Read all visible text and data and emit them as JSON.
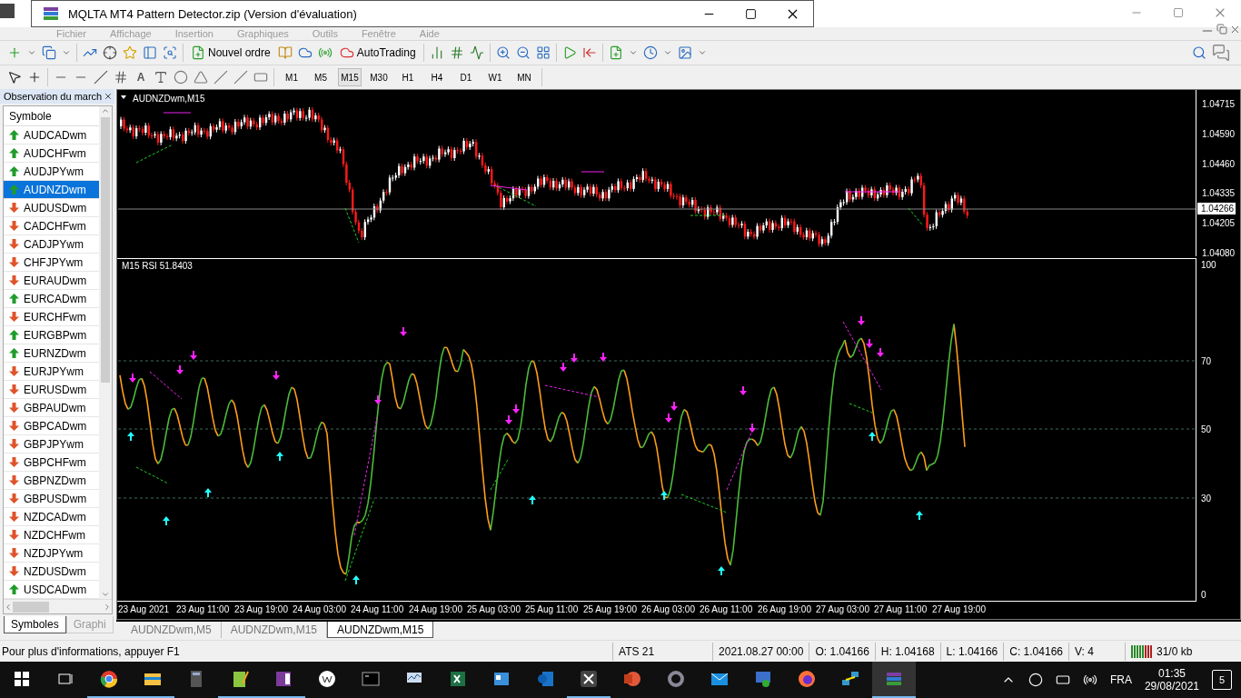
{
  "archive_window": {
    "title": "MQLTA MT4 Pattern Detector.zip (Version d'évaluation)"
  },
  "menu": [
    "Fichier",
    "Affichage",
    "Insertion",
    "Graphiques",
    "Outils",
    "Fenêtre",
    "Aide"
  ],
  "toolbar": {
    "new_order": "Nouvel ordre",
    "auto_trading": "AutoTrading",
    "text_tool": "A",
    "timeframes": [
      {
        "label": "M1",
        "selected": false
      },
      {
        "label": "M5",
        "selected": false
      },
      {
        "label": "M15",
        "selected": true
      },
      {
        "label": "M30",
        "selected": false
      },
      {
        "label": "H1",
        "selected": false
      },
      {
        "label": "H4",
        "selected": false
      },
      {
        "label": "D1",
        "selected": false
      },
      {
        "label": "W1",
        "selected": false
      },
      {
        "label": "MN",
        "selected": false
      }
    ]
  },
  "market_watch": {
    "title": "Observation du march",
    "column": "Symbole",
    "symbols": [
      {
        "name": "AUDCADwm",
        "up": true,
        "selected": false
      },
      {
        "name": "AUDCHFwm",
        "up": true,
        "selected": false
      },
      {
        "name": "AUDJPYwm",
        "up": true,
        "selected": false
      },
      {
        "name": "AUDNZDwm",
        "up": true,
        "selected": true
      },
      {
        "name": "AUDUSDwm",
        "up": false,
        "selected": false
      },
      {
        "name": "CADCHFwm",
        "up": false,
        "selected": false
      },
      {
        "name": "CADJPYwm",
        "up": false,
        "selected": false
      },
      {
        "name": "CHFJPYwm",
        "up": false,
        "selected": false
      },
      {
        "name": "EURAUDwm",
        "up": false,
        "selected": false
      },
      {
        "name": "EURCADwm",
        "up": true,
        "selected": false
      },
      {
        "name": "EURCHFwm",
        "up": false,
        "selected": false
      },
      {
        "name": "EURGBPwm",
        "up": true,
        "selected": false
      },
      {
        "name": "EURNZDwm",
        "up": true,
        "selected": false
      },
      {
        "name": "EURJPYwm",
        "up": false,
        "selected": false
      },
      {
        "name": "EURUSDwm",
        "up": false,
        "selected": false
      },
      {
        "name": "GBPAUDwm",
        "up": false,
        "selected": false
      },
      {
        "name": "GBPCADwm",
        "up": false,
        "selected": false
      },
      {
        "name": "GBPJPYwm",
        "up": false,
        "selected": false
      },
      {
        "name": "GBPCHFwm",
        "up": false,
        "selected": false
      },
      {
        "name": "GBPNZDwm",
        "up": false,
        "selected": false
      },
      {
        "name": "GBPUSDwm",
        "up": false,
        "selected": false
      },
      {
        "name": "NZDCADwm",
        "up": false,
        "selected": false
      },
      {
        "name": "NZDCHFwm",
        "up": false,
        "selected": false
      },
      {
        "name": "NZDJPYwm",
        "up": false,
        "selected": false
      },
      {
        "name": "NZDUSDwm",
        "up": false,
        "selected": false
      },
      {
        "name": "USDCADwm",
        "up": true,
        "selected": false
      }
    ],
    "tabs": [
      {
        "label": "Symboles",
        "selected": true
      },
      {
        "label": "Graphi",
        "selected": false
      }
    ]
  },
  "price_chart": {
    "title": "AUDNZDwm,M15",
    "price_labels": [
      "1.04715",
      "1.04590",
      "1.04460",
      "1.04335",
      "1.04205",
      "1.04080"
    ],
    "current_price": "1.04266"
  },
  "rsi_chart": {
    "title": "M15 RSI 51.8403",
    "levels": [
      "100",
      "70",
      "50",
      "30",
      "0"
    ]
  },
  "time_labels": [
    "23 Aug 2021",
    "23 Aug 11:00",
    "23 Aug 19:00",
    "24 Aug 03:00",
    "24 Aug 11:00",
    "24 Aug 19:00",
    "25 Aug 03:00",
    "25 Aug 11:00",
    "25 Aug 19:00",
    "26 Aug 03:00",
    "26 Aug 11:00",
    "26 Aug 19:00",
    "27 Aug 03:00",
    "27 Aug 11:00",
    "27 Aug 19:00"
  ],
  "chart_tabs": [
    {
      "label": "AUDNZDwm,M5",
      "selected": false
    },
    {
      "label": "AUDNZDwm,M15",
      "selected": false
    },
    {
      "label": "AUDNZDwm,M15",
      "selected": true
    }
  ],
  "status_bar": {
    "help": "Pour plus d'informations, appuyer F1",
    "cells": [
      "ATS 21",
      "2021.08.27 00:00",
      "O: 1.04166",
      "H: 1.04168",
      "L: 1.04166",
      "C: 1.04166",
      "V: 4"
    ],
    "traffic": "31/0 kb"
  },
  "taskbar": {
    "language": "FRA",
    "time": "01:35",
    "date": "29/08/2021",
    "notifications": "5"
  }
}
